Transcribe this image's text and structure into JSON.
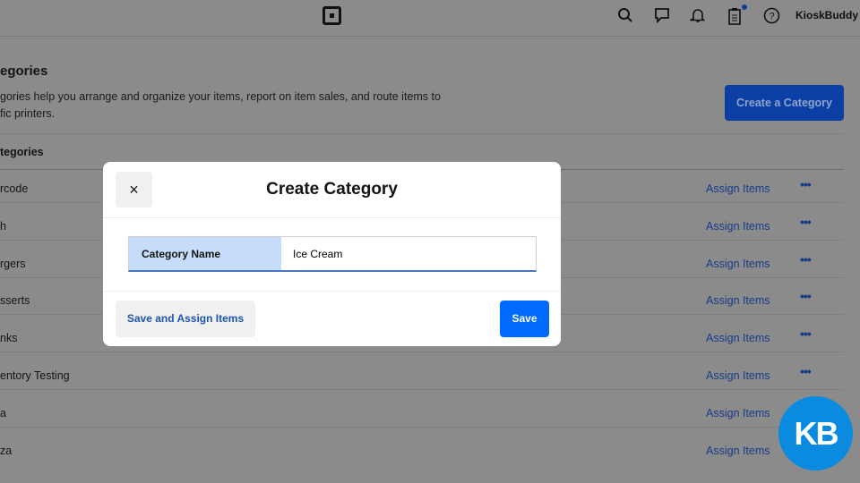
{
  "topbar": {
    "user": "KioskBuddy",
    "icons": [
      "search-icon",
      "chat-icon",
      "bell-icon",
      "clipboard-icon",
      "help-icon"
    ],
    "notification_color": "#0b3fa0"
  },
  "page": {
    "title": "egories",
    "description_line1": "gories help you arrange and organize your items, report on item sales, and route items to",
    "description_line2": "fic printers.",
    "create_label": "Create a Category",
    "list_header": "tegories"
  },
  "rows": [
    {
      "name": "rcode",
      "assign": "Assign Items",
      "more": "•••"
    },
    {
      "name": "h",
      "assign": "Assign Items",
      "more": "•••"
    },
    {
      "name": "rgers",
      "assign": "Assign Items",
      "more": "•••"
    },
    {
      "name": "sserts",
      "assign": "Assign Items",
      "more": "•••"
    },
    {
      "name": "nks",
      "assign": "Assign Items",
      "more": "•••"
    },
    {
      "name": "entory Testing",
      "assign": "Assign Items",
      "more": "•••"
    },
    {
      "name": "a",
      "assign": "Assign Items",
      "more": "•••"
    },
    {
      "name": "za",
      "assign": "Assign Items",
      "more": "•••"
    }
  ],
  "modal": {
    "title": "Create Category",
    "close": "×",
    "field_label": "Category Name",
    "field_value": "Ice Cream",
    "save_assign": "Save and Assign Items",
    "save": "Save"
  },
  "badge": {
    "text": "KB",
    "color": "#0b8be0"
  }
}
